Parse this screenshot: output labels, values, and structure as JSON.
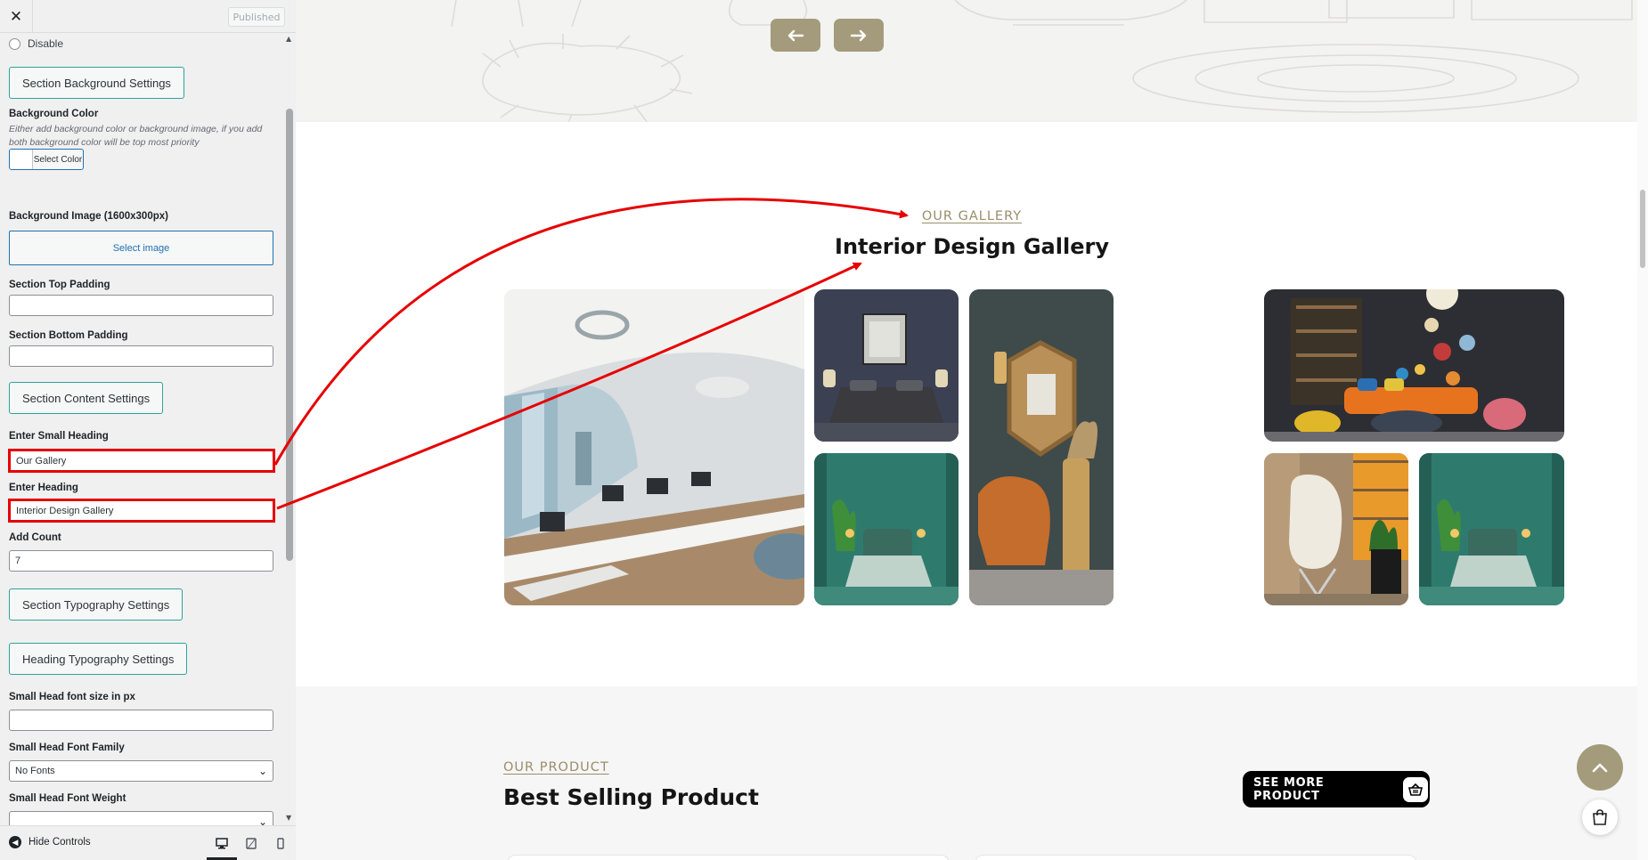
{
  "header": {
    "close_symbol": "✕",
    "published_label": "Published"
  },
  "sidebar": {
    "disable_label": "Disable",
    "bg_settings_label": "Section Background Settings",
    "bg_color_label": "Background Color",
    "bg_color_desc": "Either add background color or background image, if you add both background color will be top most priority",
    "select_color_label": "Select Color",
    "bg_image_label": "Background Image (1600x300px)",
    "select_image_label": "Select image",
    "top_padding_label": "Section Top Padding",
    "top_padding_value": "",
    "bottom_padding_label": "Section Bottom Padding",
    "bottom_padding_value": "",
    "content_settings_label": "Section Content Settings",
    "small_heading_label": "Enter Small Heading",
    "small_heading_value": "Our Gallery",
    "heading_label": "Enter Heading",
    "heading_value": "Interior Design Gallery",
    "add_count_label": "Add Count",
    "add_count_value": "7",
    "typography_settings_label": "Section Typography Settings",
    "heading_typography_label": "Heading Typography Settings",
    "small_head_size_label": "Small Head font size in px",
    "small_head_size_value": "",
    "small_head_family_label": "Small Head Font Family",
    "small_head_family_value": "No Fonts",
    "small_head_weight_label": "Small Head Font Weight",
    "small_head_weight_value": ""
  },
  "footer": {
    "hide_controls_label": "Hide Controls",
    "devices": [
      "desktop-icon",
      "tablet-icon",
      "mobile-icon"
    ]
  },
  "preview": {
    "gallery": {
      "small_heading": "OUR GALLERY",
      "heading": "Interior Design Gallery",
      "images": [
        {
          "name": "office-interior-image"
        },
        {
          "name": "navy-bedroom-image"
        },
        {
          "name": "mirror-armchair-image"
        },
        {
          "name": "dark-living-room-image"
        },
        {
          "name": "green-bedroom-image"
        },
        {
          "name": "egg-chair-image"
        },
        {
          "name": "green-bedroom-image-2"
        }
      ]
    },
    "products": {
      "small_heading": "OUR PRODUCT",
      "heading": "Best Selling Product",
      "see_more_label": "SEE MORE PRODUCT"
    }
  },
  "colors": {
    "accent_gold": "#a49b7c",
    "annotation_red": "#e60000",
    "teal_border": "#2ba49a",
    "wp_blue": "#2271b1"
  }
}
